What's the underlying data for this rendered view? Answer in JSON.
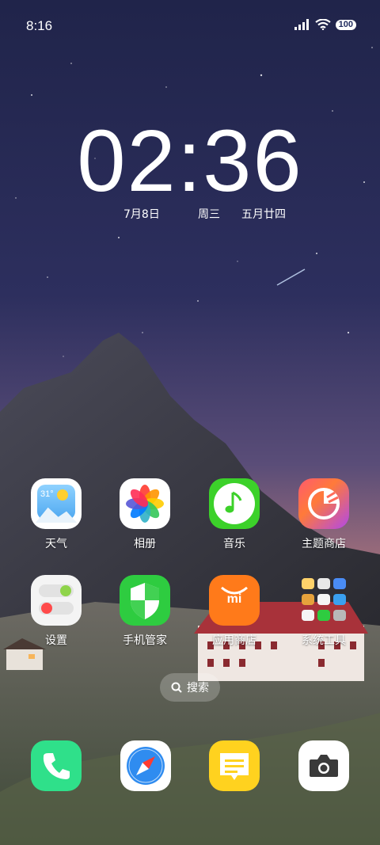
{
  "status_bar": {
    "time": "8:16",
    "battery": "100",
    "signal_icon": "signal-icon",
    "wifi_icon": "wifi-icon"
  },
  "clock": {
    "time": "02:36",
    "date": "7月8日",
    "weekday": "周三",
    "lunar": "五月廿四"
  },
  "apps_row1": [
    {
      "label": "天气",
      "badge": "31°"
    },
    {
      "label": "相册"
    },
    {
      "label": "音乐"
    },
    {
      "label": "主题商店"
    }
  ],
  "apps_row2": [
    {
      "label": "设置"
    },
    {
      "label": "手机管家"
    },
    {
      "label": "应用商店",
      "mark": "mi"
    },
    {
      "label": "系统工具"
    }
  ],
  "search": {
    "label": "搜索"
  },
  "dock": [
    "phone-icon",
    "browser-icon",
    "notes-icon",
    "camera-icon"
  ],
  "colors": {
    "music": "#3cd12a",
    "security": "#2ecc40",
    "appstore": "#ff7a1a",
    "phone": "#2fe08a",
    "notes": "#ffd21f"
  }
}
